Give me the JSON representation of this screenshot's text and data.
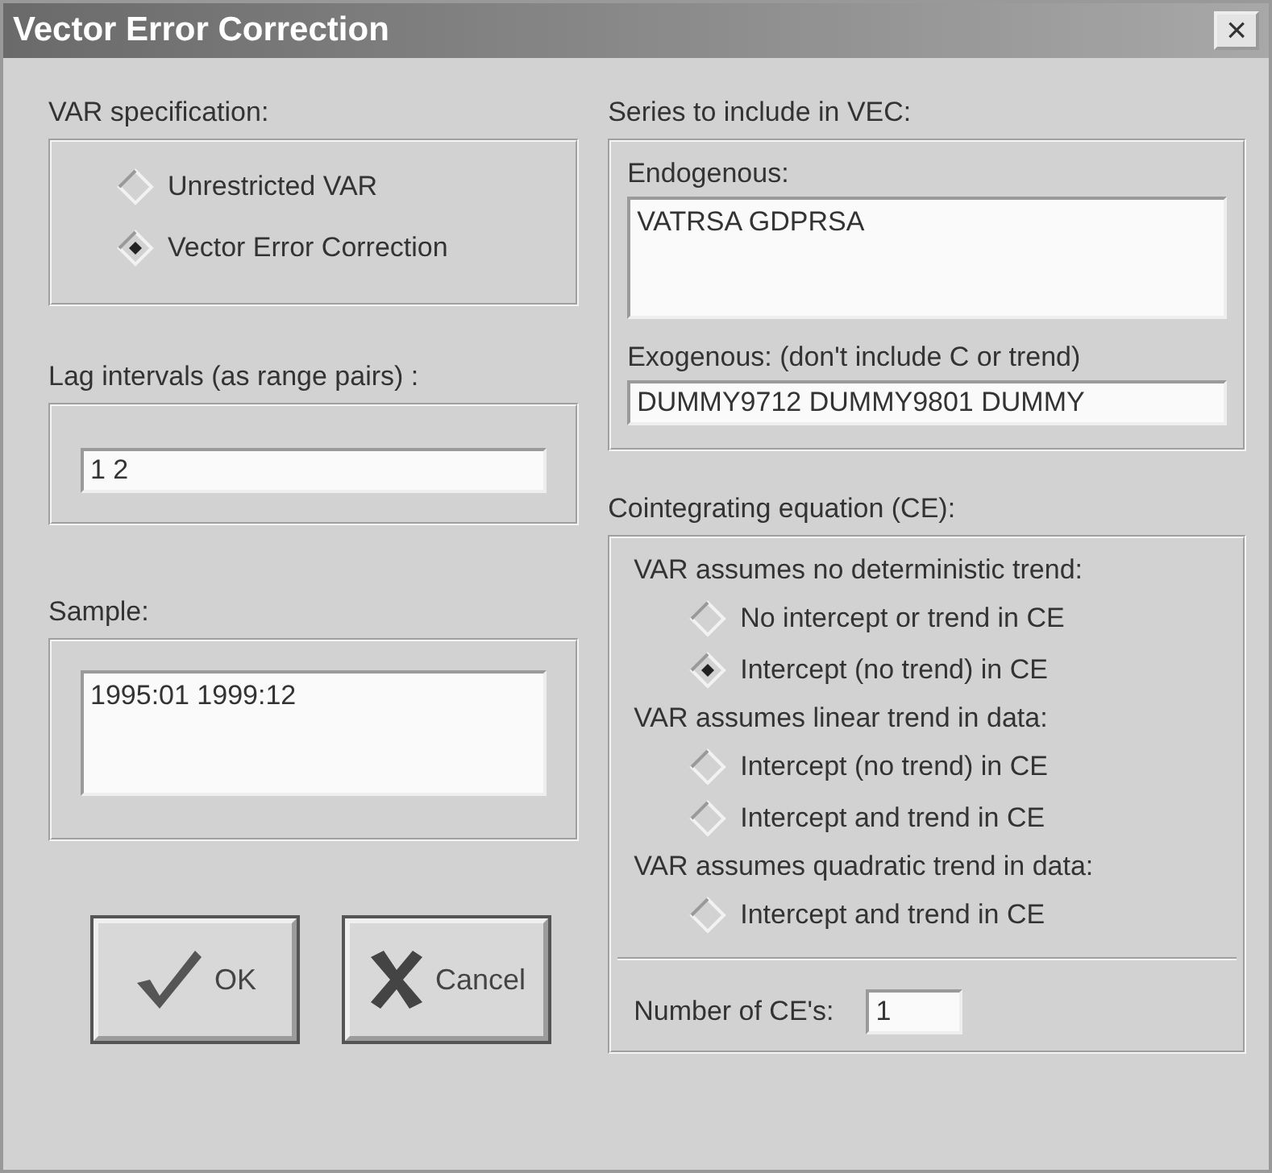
{
  "window": {
    "title": "Vector Error Correction",
    "close": "×"
  },
  "var_specification": {
    "label": "VAR specification:",
    "options": [
      {
        "label": "Unrestricted VAR",
        "selected": false
      },
      {
        "label": "Vector Error Correction",
        "selected": true
      }
    ]
  },
  "lag_intervals": {
    "label": "Lag intervals (as range pairs) :",
    "value": "1 2"
  },
  "sample": {
    "label": "Sample:",
    "value": "1995:01 1999:12"
  },
  "buttons": [
    {
      "kind": "ok",
      "label": "OK"
    },
    {
      "kind": "cancel",
      "label": "Cancel"
    }
  ],
  "series": {
    "label": "Series to include in VEC:",
    "endogenous_label": "Endogenous:",
    "endogenous": "VATRSA GDPRSA",
    "exogenous_label": "Exogenous: (don't include C or trend)",
    "exogenous": "DUMMY9712 DUMMY9801 DUMMY"
  },
  "cointegrating": {
    "label": "Cointegrating equation (CE):",
    "groups": [
      {
        "heading": "VAR assumes no deterministic trend:",
        "options": [
          {
            "label": "No intercept or trend in CE",
            "selected": false
          },
          {
            "label": "Intercept (no trend) in CE",
            "selected": true
          }
        ]
      },
      {
        "heading": "VAR assumes linear trend in data:",
        "options": [
          {
            "label": "Intercept (no trend) in CE",
            "selected": false
          },
          {
            "label": "Intercept and trend in CE",
            "selected": false
          }
        ]
      },
      {
        "heading": "VAR assumes quadratic trend in data:",
        "options": [
          {
            "label": "Intercept and trend in CE",
            "selected": false
          }
        ]
      }
    ],
    "number_label": "Number of CE's:",
    "number": "1"
  }
}
